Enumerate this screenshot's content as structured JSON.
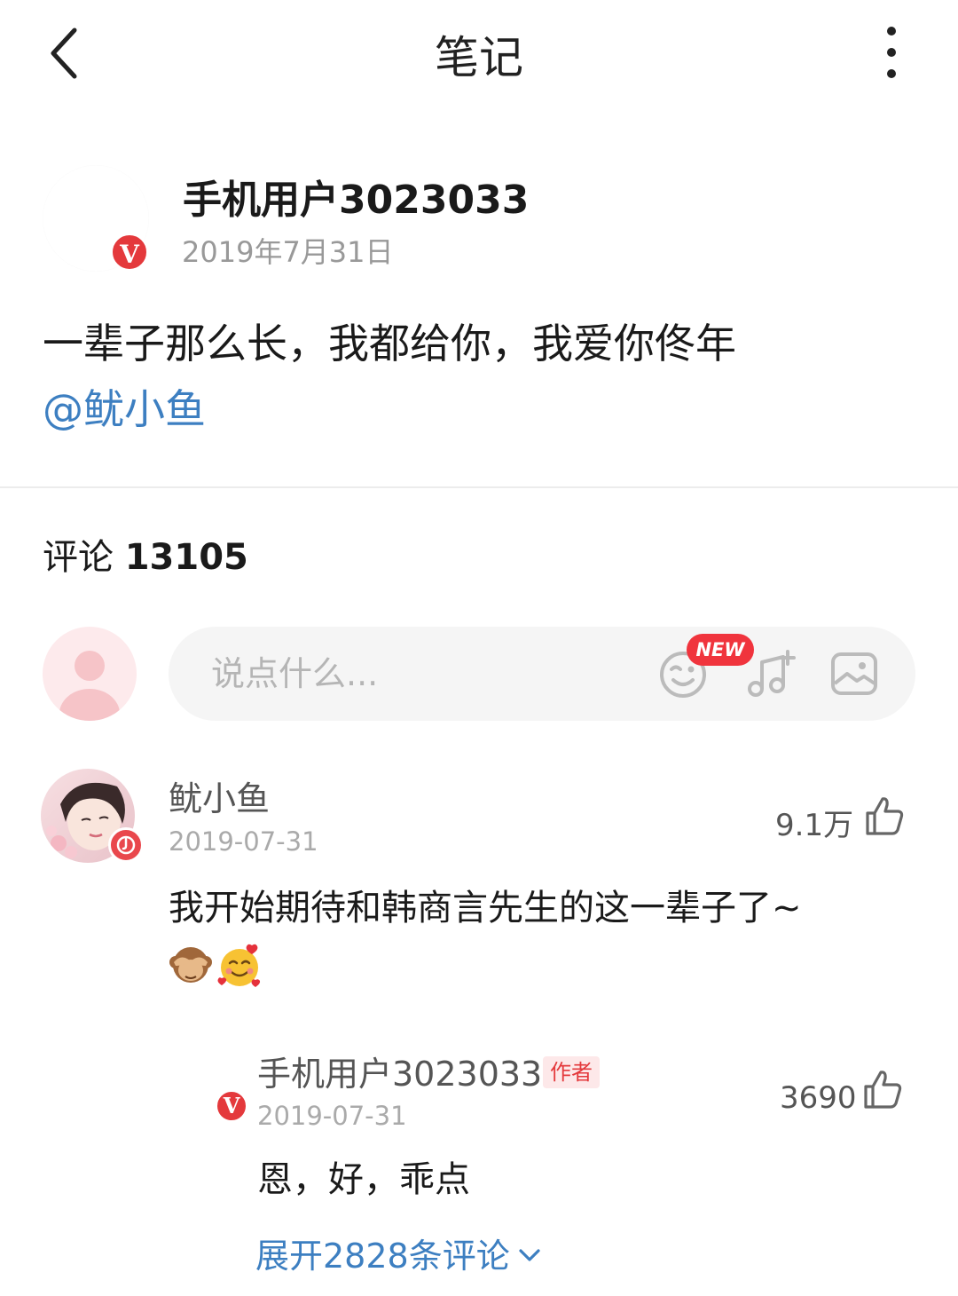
{
  "nav": {
    "title": "笔记"
  },
  "post": {
    "author_name": "手机用户3023033",
    "date": "2019年7月31日",
    "text": "一辈子那么长，我都给你，我爱你佟年",
    "mention": "@鱿小鱼"
  },
  "comments_section": {
    "label": "评论",
    "count": "13105"
  },
  "input": {
    "placeholder": "说点什么...",
    "new_badge": "NEW"
  },
  "comment": {
    "name": "鱿小鱼",
    "date": "2019-07-31",
    "likes": "9.1万",
    "text": "我开始期待和韩商言先生的这一辈子了~",
    "emojis": [
      "see-no-evil-monkey",
      "smiling-face-with-hearts"
    ]
  },
  "reply": {
    "name": "手机用户3023033",
    "author_tag": "作者",
    "date": "2019-07-31",
    "likes": "3690",
    "text": "恩，好，乖点",
    "expand_label": "展开2828条评论"
  },
  "colors": {
    "accent_blue": "#3d7fc1",
    "badge_red": "#e4393c",
    "new_badge_red": "#f0343d"
  }
}
